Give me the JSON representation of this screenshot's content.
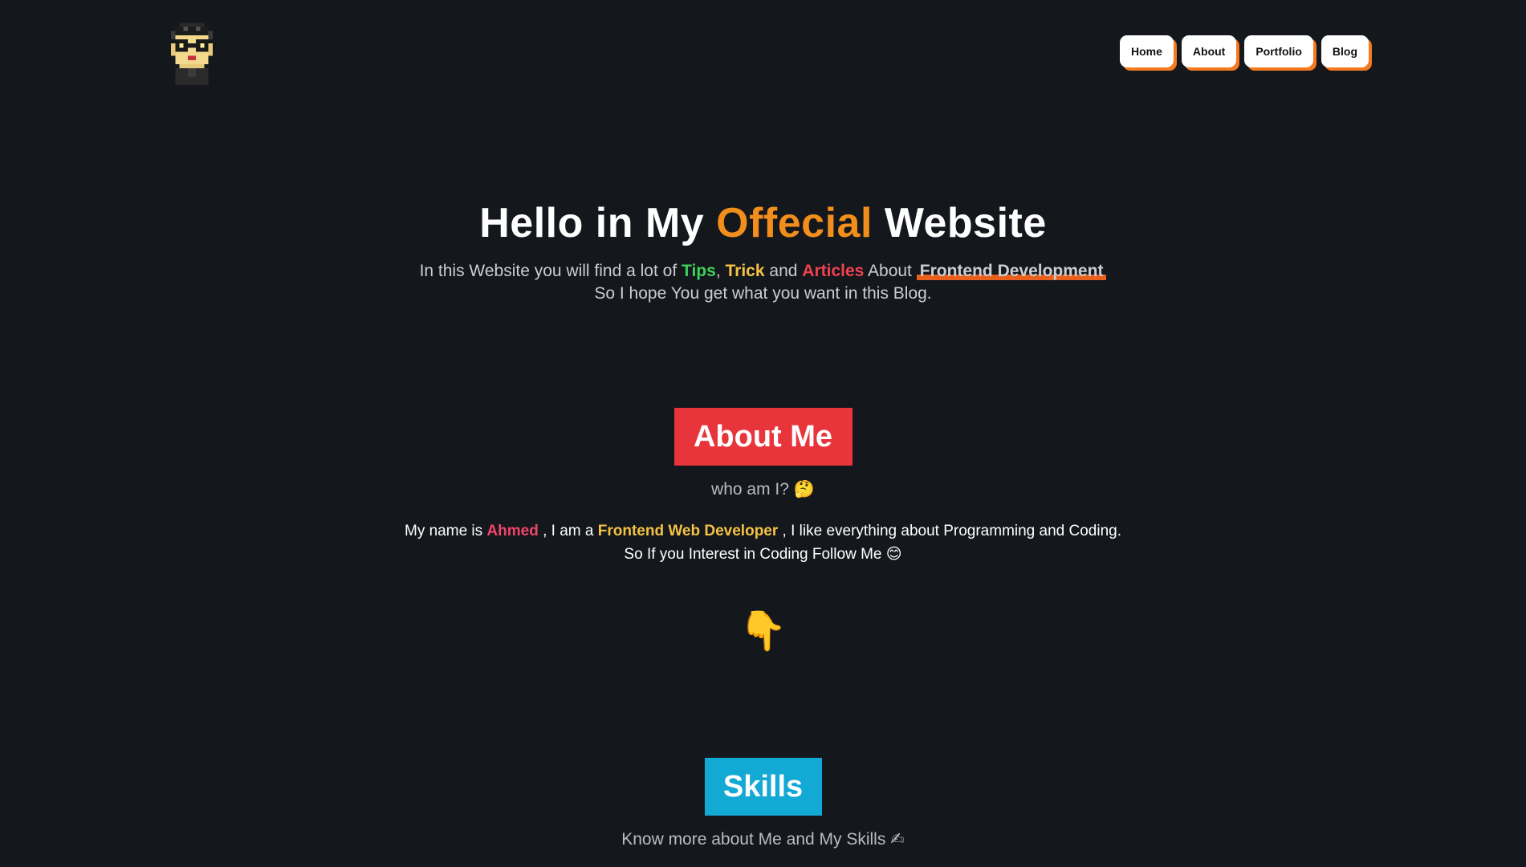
{
  "header": {
    "logo_icon": "pixel-avatar-icon",
    "nav": {
      "home": "Home",
      "about": "About",
      "portfolio": "Portfolio",
      "blog": "Blog"
    }
  },
  "hero": {
    "title_part1": "Hello in My",
    "title_accent": "Offecial",
    "title_part2": "Website",
    "line1_prefix": "In this Website you will find a lot of",
    "tips": "Tips",
    "comma": ",",
    "trick": "Trick",
    "and": "and",
    "articles": "Articles",
    "about": "About",
    "frontend": "Frontend Development",
    "line2": "So I hope You get what you want in this Blog."
  },
  "about_section": {
    "title": "About Me",
    "subtitle": "who am I?",
    "subtitle_emoji": "🤔",
    "body_prefix": "My name is",
    "name": "Ahmed",
    "body_mid": ", I am a",
    "role": "Frontend Web Developer",
    "body_suffix": ", I like everything about Programming and Coding.",
    "body_line2": "So If you Interest in Coding Follow Me",
    "body_line2_emoji": "😊",
    "pointer_emoji": "👇"
  },
  "skills_section": {
    "title": "Skills",
    "subtitle": "Know more about Me and My Skills",
    "subtitle_emoji": "✍"
  },
  "colors": {
    "background": "#14171c",
    "accent_orange": "#f28e1c",
    "nav_shadow": "#f47a1f",
    "tips_green": "#3ecf5a",
    "trick_yellow": "#f5c242",
    "articles_red": "#f0414f",
    "about_badge": "#e8353c",
    "skills_badge": "#12a9d4",
    "name_pink": "#f0456b"
  }
}
